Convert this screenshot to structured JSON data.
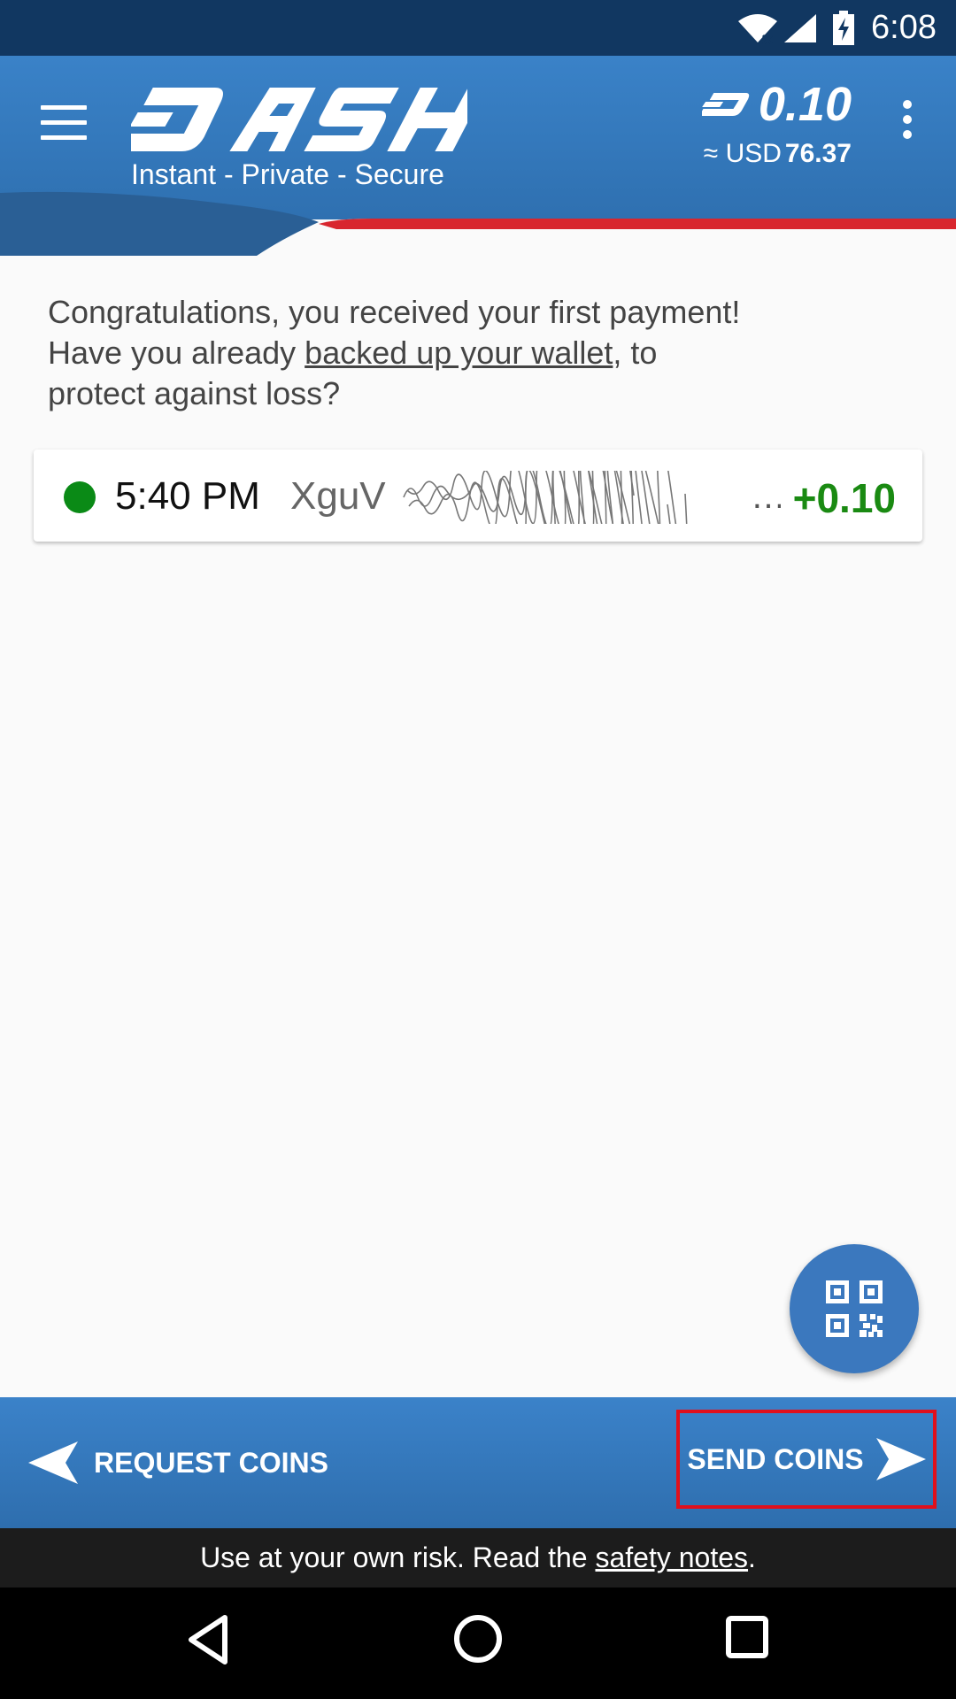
{
  "status_bar": {
    "time": "6:08",
    "icons": [
      "wifi-icon",
      "signal-icon",
      "battery-charging-icon"
    ]
  },
  "app_bar": {
    "brand": "DASH",
    "tagline": "Instant - Private - Secure",
    "balance": "0.10",
    "fiat_prefix": "≈ USD",
    "fiat_value": "76.37",
    "icons": [
      "menu-icon",
      "dash-currency-icon",
      "more-vert-icon"
    ]
  },
  "notice": {
    "line1": "Congratulations, you received your first payment!",
    "line2_pre": "Have you already ",
    "line2_link": "backed up your wallet",
    "line2_post": ", to",
    "line3": "protect against loss?"
  },
  "transactions": [
    {
      "time": "5:40 PM",
      "address": "XguV",
      "amount": "+0.10",
      "status_color": "#0a8a16"
    }
  ],
  "fab": {
    "icon": "qr-code-icon"
  },
  "bottom_bar": {
    "request_label": "REQUEST COINS",
    "send_label": "SEND COINS"
  },
  "footer": {
    "pre": "Use at your own risk. Read the ",
    "link": "safety notes",
    "post": "."
  },
  "colors": {
    "primary": "#3a82c8",
    "status_bar": "#113761",
    "accent_red": "#e0101c",
    "received_green": "#1a8a12"
  }
}
